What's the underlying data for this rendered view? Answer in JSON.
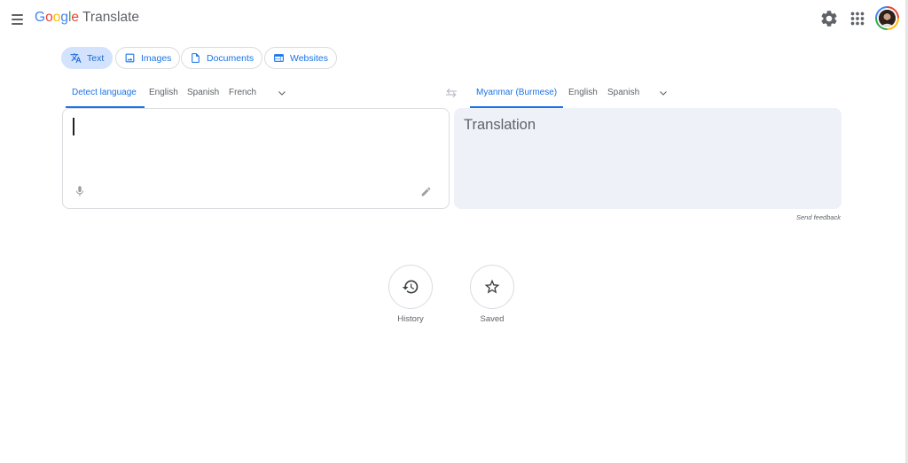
{
  "header": {
    "logo_letters": [
      "G",
      "o",
      "o",
      "g",
      "l",
      "e"
    ],
    "product": "Translate"
  },
  "modes": [
    {
      "label": "Text",
      "icon": "translate-icon",
      "active": true
    },
    {
      "label": "Images",
      "icon": "image-icon",
      "active": false
    },
    {
      "label": "Documents",
      "icon": "document-icon",
      "active": false
    },
    {
      "label": "Websites",
      "icon": "website-icon",
      "active": false
    }
  ],
  "source_langs": {
    "detect": "Detect language",
    "items": [
      "English",
      "Spanish",
      "French"
    ],
    "active": "Detect language"
  },
  "target_langs": {
    "items": [
      "Myanmar (Burmese)",
      "English",
      "Spanish"
    ],
    "active": "Myanmar (Burmese)"
  },
  "source": {
    "value": ""
  },
  "target": {
    "placeholder": "Translation"
  },
  "feedback": "Send feedback",
  "bottom": {
    "history": "History",
    "saved": "Saved"
  },
  "colors": {
    "accent": "#1a73e8",
    "chip_active_bg": "#d3e3fd",
    "target_panel_bg": "#eef1f8"
  }
}
